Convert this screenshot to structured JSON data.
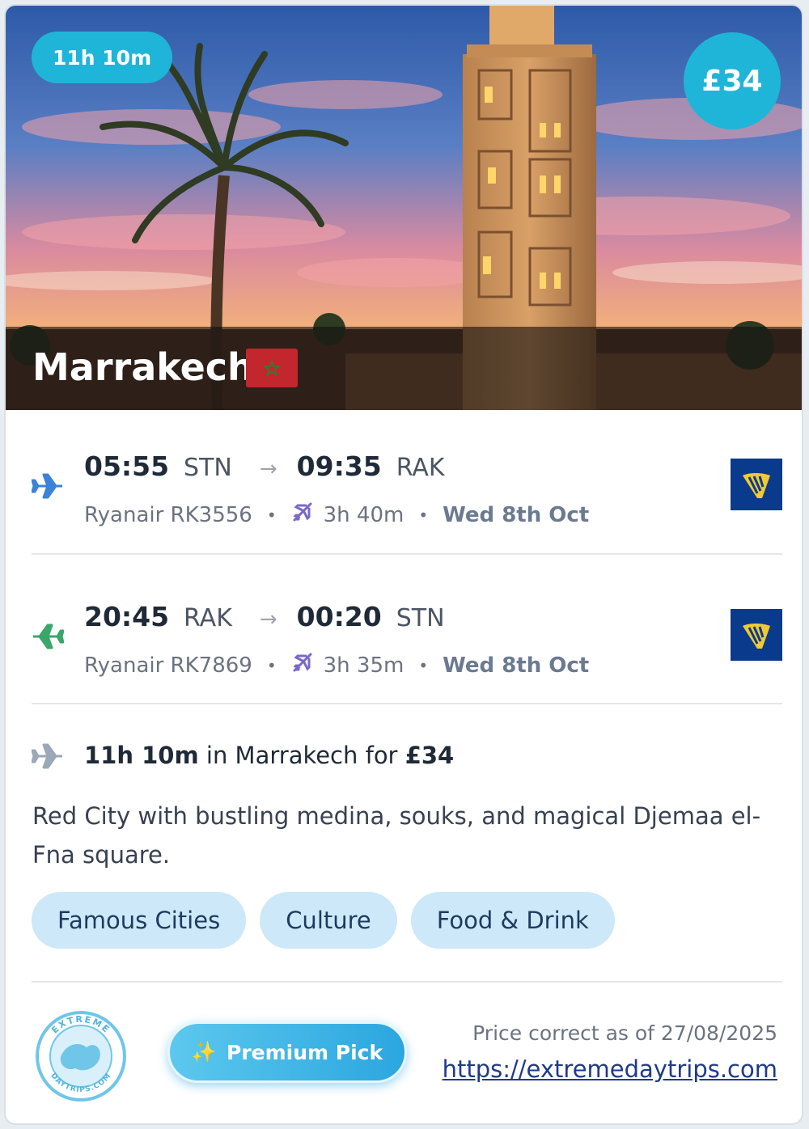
{
  "hero": {
    "duration_badge": "11h 10m",
    "price_badge": "£34",
    "city": "Marrakech",
    "flag": "morocco-flag"
  },
  "outbound": {
    "depart_time": "05:55",
    "depart_code": "STN",
    "arrow": "→",
    "arrive_time": "09:35",
    "arrive_code": "RAK",
    "flight": "Ryanair RK3556",
    "separator": "•",
    "duration": "3h 40m",
    "date": "Wed 8th Oct",
    "icon": "plane-icon",
    "icon_color": "#3b82d8",
    "airline_logo": "ryanair-logo"
  },
  "return": {
    "depart_time": "20:45",
    "depart_code": "RAK",
    "arrow": "→",
    "arrive_time": "00:20",
    "arrive_code": "STN",
    "flight": "Ryanair RK7869",
    "separator": "•",
    "duration": "3h 35m",
    "date": "Wed 8th Oct",
    "icon": "plane-icon",
    "icon_color": "#3aa66a",
    "airline_logo": "ryanair-logo"
  },
  "summary": {
    "duration": "11h 10m",
    "in_text": " in Marrakech for ",
    "price": "£34"
  },
  "description": "Red City with bustling medina, souks, and magical Djemaa el-Fna square.",
  "tags": [
    "Famous Cities",
    "Culture",
    "Food & Drink"
  ],
  "footer": {
    "logo_top_text": "EXTREME",
    "logo_bottom_text": "DAYTRIPS.COM",
    "premium_icon": "✨",
    "premium_label": "Premium Pick",
    "price_note": "Price correct as of 27/08/2025",
    "link": "https://extremedaytrips.com"
  },
  "colors": {
    "accent": "#1fb5d8",
    "tag_bg": "#cde8f8",
    "flag_red": "#c1272d",
    "ryanair_blue": "#0a3a8c",
    "ryanair_yellow": "#f1c933"
  }
}
